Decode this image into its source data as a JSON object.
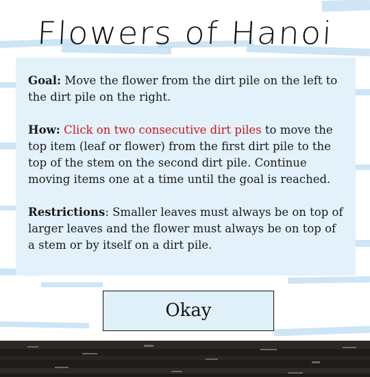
{
  "title": "Flowers of Hanoi",
  "instructions": {
    "goal": {
      "label": "Goal:",
      "text": " Move the flower from the dirt pile on the left to the dirt pile on the right."
    },
    "how": {
      "label": "How:",
      "highlight": "Click on two consecutive dirt piles",
      "text": " to move the top item (leaf or flower) from the first dirt pile to the top of the stem on the second dirt pile. Continue moving items one at a time until the goal is reached."
    },
    "restrictions": {
      "label": "Restrictions",
      "text": ": Smaller leaves must always be on top of larger leaves and the flower must always be on top of a stem or by itself on a dirt pile."
    }
  },
  "okay_label": "Okay",
  "colors": {
    "highlight": "#c8161e",
    "panel": "#e2f1fa",
    "button": "#dff0f8",
    "dirt": "#1f1b1a"
  }
}
